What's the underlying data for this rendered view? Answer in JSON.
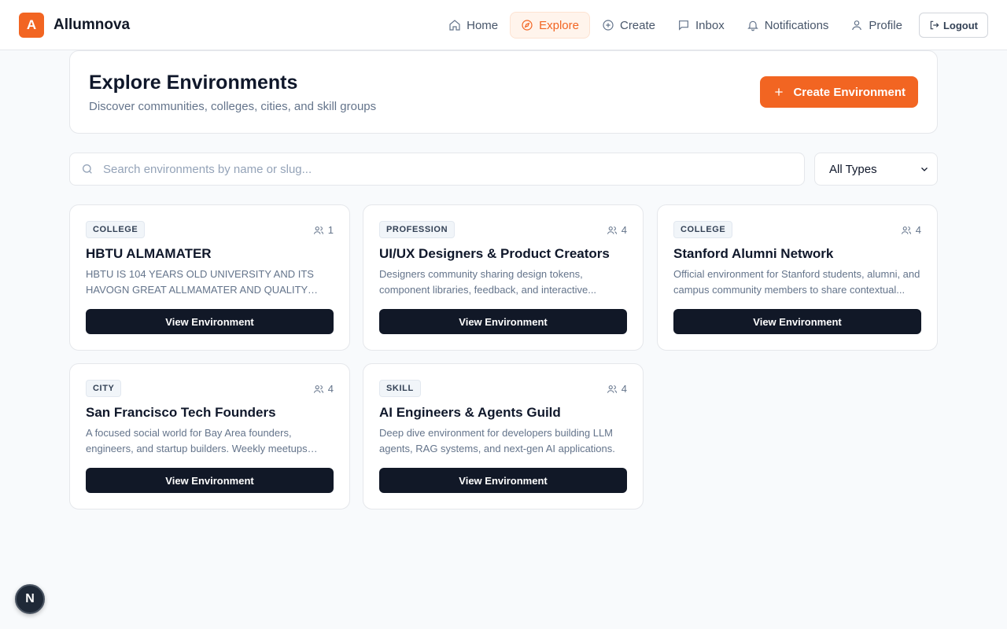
{
  "brand": {
    "logo_letter": "A",
    "name": "Allumnova",
    "accent": "#f26522"
  },
  "nav": {
    "items": [
      {
        "label": "Home",
        "icon": "home-icon",
        "active": false
      },
      {
        "label": "Explore",
        "icon": "compass-icon",
        "active": true
      },
      {
        "label": "Create",
        "icon": "plus-circle-icon",
        "active": false
      },
      {
        "label": "Inbox",
        "icon": "message-icon",
        "active": false
      },
      {
        "label": "Notifications",
        "icon": "bell-icon",
        "active": false
      },
      {
        "label": "Profile",
        "icon": "user-icon",
        "active": false
      }
    ],
    "logout_label": "Logout"
  },
  "hero": {
    "title": "Explore Environments",
    "subtitle": "Discover communities, colleges, cities, and skill groups",
    "create_label": "Create Environment"
  },
  "search": {
    "placeholder": "Search environments by name or slug...",
    "value": ""
  },
  "filter": {
    "selected": "All Types"
  },
  "cards": [
    {
      "type": "COLLEGE",
      "members": "1",
      "title": "HBTU ALMAMATER",
      "description": "HBTU IS 104 YEARS OLD UNIVERSITY AND ITS HAVOGN GREAT ALLMAMATER AND QUALITY INFRA...",
      "button": "View Environment"
    },
    {
      "type": "PROFESSION",
      "members": "4",
      "title": "UI/UX Designers & Product Creators",
      "description": "Designers community sharing design tokens, component libraries, feedback, and interactive...",
      "button": "View Environment"
    },
    {
      "type": "COLLEGE",
      "members": "4",
      "title": "Stanford Alumni Network",
      "description": "Official environment for Stanford students, alumni, and campus community members to share contextual...",
      "button": "View Environment"
    },
    {
      "type": "CITY",
      "members": "4",
      "title": "San Francisco Tech Founders",
      "description": "A focused social world for Bay Area founders, engineers, and startup builders. Weekly meetups and...",
      "button": "View Environment"
    },
    {
      "type": "SKILL",
      "members": "4",
      "title": "AI Engineers & Agents Guild",
      "description": "Deep dive environment for developers building LLM agents, RAG systems, and next-gen AI applications.",
      "button": "View Environment"
    }
  ],
  "dev_badge": {
    "letter": "N"
  }
}
